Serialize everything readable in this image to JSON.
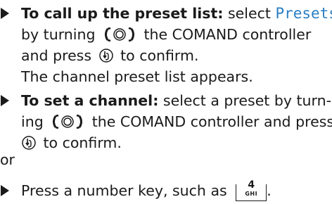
{
  "item1": {
    "bold_lead": "To call up the preset list:",
    "line1_a": " select ",
    "line1_highlight": "Presets",
    "line2_a": "by turning ",
    "line2_b": " the COMAND controller",
    "line3_a": "and press ",
    "line3_b": " to confirm.",
    "line4": "The channel preset list appears."
  },
  "item2": {
    "bold_lead": "To set a channel:",
    "line1_a": " select a preset by turn-",
    "line2_a": "ing ",
    "line2_b": " the COMAND controller and press",
    "line3_b": " to confirm."
  },
  "or_text": "or",
  "item3": {
    "text": "Press a number key, such as ",
    "key_number": "4",
    "key_letters": "GHI",
    "end": "."
  },
  "icons": {
    "bullet": "triangle-bullet-icon",
    "rotate": "controller-rotate-icon",
    "press": "controller-press-icon",
    "key": "number-key-icon"
  },
  "colors": {
    "text": "#1a1a1a",
    "highlight": "#2a7fc4"
  }
}
